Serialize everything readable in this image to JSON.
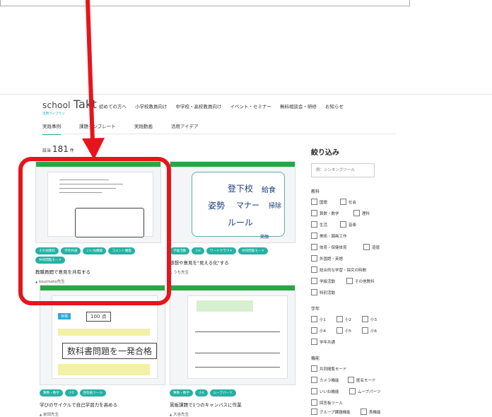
{
  "header": {
    "logo_top": "school",
    "logo_main": "Takt",
    "logo_sub": "活用ライブラリ",
    "nav": [
      "初めての方へ",
      "小学校教員向け",
      "中学校・高校教員向け",
      "イベント・セミナー",
      "無料相談会・研修",
      "お知らせ"
    ]
  },
  "tabs": [
    "実践事例",
    "課題テンプレート",
    "実践動画",
    "活用アイデア"
  ],
  "results": {
    "prefix": "該当",
    "count": "181",
    "suffix": "件"
  },
  "cards": [
    {
      "tags": [
        "その他教科",
        "学年共通",
        "いいね機能",
        "コメント機能",
        "共同閲覧モード"
      ],
      "title": "教職員間で意見を共有する",
      "author": "kouimoto先生"
    },
    {
      "tags": [
        "学級活動",
        "小4",
        "ワードクラウド",
        "共同閲覧モード"
      ],
      "title": "感想や意見を\"見える化\"する",
      "author": "うち先生",
      "thumb_words": [
        "登下校",
        "給食",
        "姿勢",
        "マナー",
        "掃除",
        "ルール",
        "笑顔"
      ]
    },
    {
      "tags": [
        "算数・数学",
        "小5",
        "回答板ツール"
      ],
      "title": "学びのサイクルで自己学習力を高める",
      "author": "前田先生",
      "thumb_texts": [
        "目標",
        "100 点",
        "数科書問題を一発合格"
      ]
    },
    {
      "tags": [
        "算数・数学",
        "小4",
        "ムーブパーツ"
      ],
      "title": "黒板課題で1つのキャンバスに作業",
      "author": "大谷先生"
    }
  ],
  "sidebar": {
    "title": "絞り込み",
    "search_placeholder": "例：シンキングツール",
    "subject_label": "教科",
    "subjects": [
      "国語",
      "社会",
      "算数・数学",
      "理科",
      "生活",
      "音楽",
      "美術・図画工作",
      "体育・保健体育",
      "道徳",
      "外国語・英語",
      "総合的な学習・探究の時間",
      "学級活動",
      "その他教科",
      "特別活動"
    ],
    "grade_label": "学年",
    "grades": [
      "小1",
      "小2",
      "小3",
      "小4",
      "小5",
      "小6",
      "学年共通"
    ],
    "feature_label": "機能",
    "features": [
      "共同閲覧モード",
      "カメラ機能",
      "匿名モード",
      "いいね機能",
      "ムーブパーツ",
      "回答板ツール",
      "グループ課題機能",
      "表機能"
    ]
  },
  "colors": {
    "accent": "#29b6a8",
    "highlight": "#e8141b",
    "thumb_bar": "#28a745"
  }
}
